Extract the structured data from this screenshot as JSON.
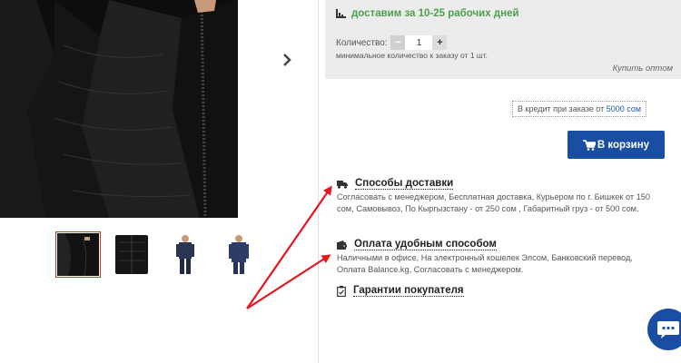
{
  "delivery": {
    "days_text": "доставим за 10-25 рабочих дней"
  },
  "quantity": {
    "label": "Количество:",
    "minus": "−",
    "value": "1",
    "plus": "+",
    "min_note": "минимальное количество к заказу от 1 шт."
  },
  "wholesale": "Купить оптом",
  "credit": {
    "text": "В кредит при заказе от",
    "amount": "5000 сом"
  },
  "cart_button": "В корзину",
  "info": {
    "delivery_title": "Способы доставки",
    "delivery_text": "Согласовать с менеджером, Бесплатная доставка, Курьером по г. Бишкек от 150 сом, Самовывоз, По Кыргызстану - от 250 сом , Габаритный груз - от 500 сом.",
    "payment_title": "Оплата удобным способом",
    "payment_text": "Наличными в офисе, На электронный кошелек Элсом, Банковский перевод, Оплата Balance.kg, Согласовать с менеджером.",
    "guarantee_title": "Гарантии покупателя"
  },
  "colors": {
    "accent_blue": "#1a4ea3",
    "green": "#4aa04a",
    "arrow_red": "#e8141b"
  },
  "icons": [
    "next-chevron-icon",
    "truck-icon",
    "wallet-icon",
    "document-check-icon",
    "cart-icon",
    "chat-icon"
  ]
}
